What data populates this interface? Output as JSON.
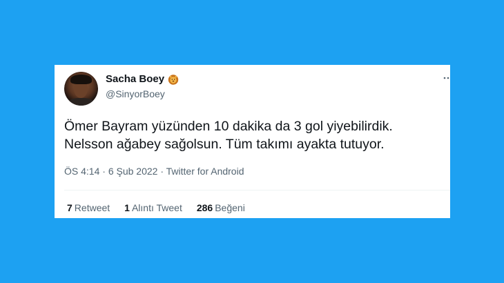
{
  "tweet": {
    "author": {
      "display_name": "Sacha Boey",
      "handle": "@SinyorBoey",
      "badge_icon": "lion-face-icon"
    },
    "text_lines": [
      "Ömer Bayram yüzünden 10 dakika da 3 gol yiyebilirdik.",
      "Nelsson ağabey sağolsun. Tüm takımı ayakta tutuyor."
    ],
    "meta": {
      "time": "ÖS 4:14",
      "separator": "·",
      "date": "6 Şub 2022",
      "source": "Twitter for Android"
    },
    "stats": [
      {
        "count": "7",
        "label": "Retweet"
      },
      {
        "count": "1",
        "label": "Alıntı Tweet"
      },
      {
        "count": "286",
        "label": "Beğeni"
      }
    ]
  },
  "colors": {
    "background": "#1da1f2",
    "card": "#ffffff",
    "text_primary": "#0f1419",
    "text_secondary": "#536471"
  }
}
